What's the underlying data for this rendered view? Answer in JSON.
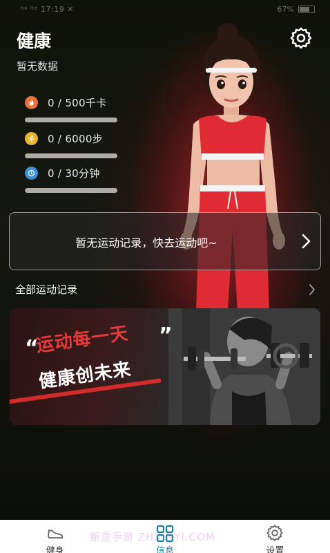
{
  "status_bar": {
    "left_text": "ᵒᵃ ˡᵗᵉ 17:19 ✕",
    "battery": "67%"
  },
  "header": {
    "title": "健康",
    "subtitle": "暂无数据",
    "settings_icon": "gear-icon"
  },
  "stats": [
    {
      "icon": "flame-icon",
      "color": "#e8743b",
      "value": "0 / 500千卡",
      "progress": 0
    },
    {
      "icon": "runner-icon",
      "color": "#e8b52a",
      "value": "0 / 6000步",
      "progress": 0
    },
    {
      "icon": "clock-icon",
      "color": "#3c8fd6",
      "value": "0 / 30分钟",
      "progress": 0
    }
  ],
  "record_card": {
    "text": "暂无运动记录，快去运动吧~"
  },
  "all_records": {
    "label": "全部运动记录"
  },
  "banner": {
    "open_quote": "“",
    "line1": "运动每一天",
    "close_quote": "”",
    "line2": "健康创未来"
  },
  "bottom_nav": [
    {
      "label": "健身",
      "icon": "sneaker-icon",
      "active": false
    },
    {
      "label": "信息",
      "icon": "grid-icon",
      "active": true
    },
    {
      "label": "设置",
      "icon": "gear-icon",
      "active": false
    }
  ],
  "watermark": "新意手游 ZHXINYI.COM",
  "colors": {
    "accent_active": "#1c7aa6",
    "banner_red": "#e43a3a"
  }
}
